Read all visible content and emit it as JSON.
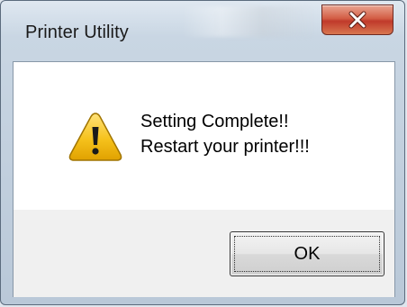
{
  "window": {
    "title": "Printer Utility"
  },
  "title_bar": {
    "close_icon": "close-icon"
  },
  "dialog": {
    "icon": "warning-icon",
    "message_line1": "Setting Complete!!",
    "message_line2": "Restart your printer!!!"
  },
  "buttons": {
    "ok_label": "OK"
  },
  "colors": {
    "close_button": "#c7473a",
    "warning_fill": "#f6c21c",
    "content_bg": "#ffffff",
    "button_area_bg": "#f0f0f0"
  }
}
